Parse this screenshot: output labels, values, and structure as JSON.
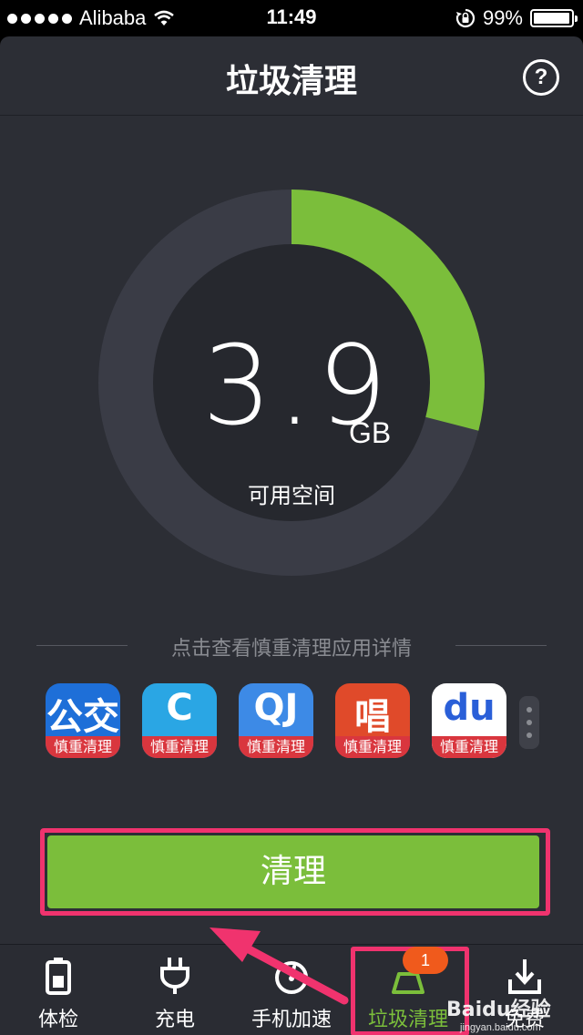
{
  "status_bar": {
    "carrier": "Alibaba",
    "time": "11:49",
    "battery": "99%",
    "icons": [
      "signal-dots-icon",
      "wifi-icon",
      "rotation-lock-icon",
      "battery-icon"
    ]
  },
  "nav": {
    "title": "垃圾清理",
    "help_icon": "question-mark",
    "help_glyph": "?"
  },
  "storage": {
    "free_value": "3.9",
    "free_unit": "GB",
    "free_label": "可用空间",
    "used_fraction": 0.29,
    "colors": {
      "used": "#7bbe3b",
      "free": "#3a3c46",
      "inner": "#26282e"
    }
  },
  "apps_section": {
    "hint": "点击查看慎重清理应用详情",
    "apps": [
      {
        "name": "bus-app",
        "glyph": "公交",
        "tag": "慎重清理",
        "bg": "#1e6fd8",
        "fg": "#ffffff"
      },
      {
        "name": "refresh-app",
        "glyph": "C",
        "tag": "慎重清理",
        "bg": "#2aa6e4",
        "fg": "#ffffff"
      },
      {
        "name": "qq-app",
        "glyph": "QJ",
        "tag": "慎重清理",
        "bg": "#3d8ae6",
        "fg": "#ffffff"
      },
      {
        "name": "sing-app",
        "glyph": "唱",
        "tag": "慎重清理",
        "bg": "#e04a2a",
        "fg": "#ffffff"
      },
      {
        "name": "baidu-app",
        "glyph": "du",
        "tag": "慎重清理",
        "bg": "#ffffff",
        "fg": "#2a5fd8"
      }
    ]
  },
  "actions": {
    "clean_label": "清理"
  },
  "tabs": [
    {
      "label": "体检",
      "icon": "battery-icon"
    },
    {
      "label": "充电",
      "icon": "plug-icon"
    },
    {
      "label": "手机加速",
      "icon": "speedometer-icon"
    },
    {
      "label": "垃圾清理",
      "icon": "broom-icon",
      "active": true,
      "badge": "1"
    },
    {
      "label": "免费",
      "icon": "download-icon"
    }
  ],
  "watermark": {
    "brand": "Baidu经验",
    "url": "jingyan.baidu.com"
  },
  "accent_colors": {
    "highlight": "#f0336e",
    "green": "#7bbe3b",
    "badge": "#f05a1c"
  }
}
